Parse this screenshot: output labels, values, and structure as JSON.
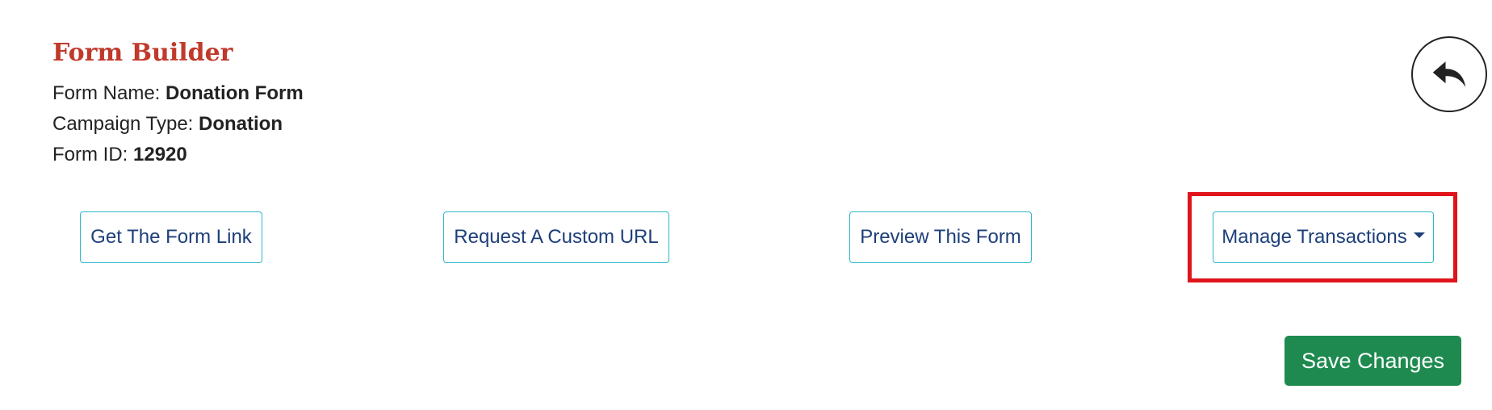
{
  "header": {
    "title": "Form Builder",
    "form_name_label": "Form Name:",
    "form_name_value": "Donation Form",
    "campaign_type_label": "Campaign Type:",
    "campaign_type_value": "Donation",
    "form_id_label": "Form ID:",
    "form_id_value": "12920"
  },
  "actions": {
    "get_link": "Get The Form Link",
    "custom_url": "Request A Custom URL",
    "preview": "Preview This Form",
    "manage_transactions": "Manage Transactions"
  },
  "footer": {
    "save": "Save Changes"
  },
  "icons": {
    "back": "undo-arrow-icon",
    "dropdown": "caret-down-icon"
  },
  "colors": {
    "title": "#c0392b",
    "button_border": "#2bb7c9",
    "button_text": "#1e3f7a",
    "save_bg": "#1e8a4f",
    "highlight": "#e0141b"
  }
}
